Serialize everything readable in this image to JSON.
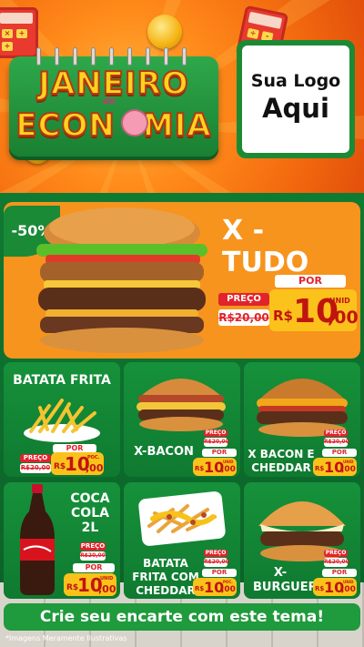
{
  "header": {
    "title_line1": "JANEIRO",
    "title_connector": "de",
    "title_line2_a": "ECON",
    "title_line2_b": "MIA",
    "logo_line1": "Sua Logo",
    "logo_line2": "Aqui",
    "calc_keys": [
      "×",
      "+",
      "÷",
      "-",
      "+",
      "×"
    ]
  },
  "featured": {
    "discount": "-50%",
    "name": "X - TUDO",
    "preco_label": "PREÇO",
    "old_price": "R$20,00",
    "por_label": "POR",
    "currency": "R$",
    "price_int": "10",
    "price_dec": ",00",
    "unit": "UNID"
  },
  "products": [
    {
      "name": "BATATA FRITA",
      "preco_label": "PREÇO",
      "old_price": "R$20,00",
      "por_label": "POR",
      "currency": "R$",
      "price_int": "10",
      "price_dec": ",00",
      "unit": "POC."
    },
    {
      "name": "X-BACON",
      "preco_label": "PREÇO",
      "old_price": "R$20,00",
      "por_label": "POR",
      "currency": "R$",
      "price_int": "10",
      "price_dec": ",00",
      "unit": "UNID"
    },
    {
      "name": "X BACON E CHEDDAR",
      "preco_label": "PREÇO",
      "old_price": "R$20,00",
      "por_label": "POR",
      "currency": "R$",
      "price_int": "10",
      "price_dec": ",00",
      "unit": "UNID"
    },
    {
      "name": "COCA COLA 2L",
      "preco_label": "PREÇO",
      "old_price": "R$20,00",
      "por_label": "POR",
      "currency": "R$",
      "price_int": "10",
      "price_dec": ",00",
      "unit": "UNID"
    },
    {
      "name": "BATATA FRITA COM CHEDDAR",
      "preco_label": "PREÇO",
      "old_price": "R$20,00",
      "por_label": "POR",
      "currency": "R$",
      "price_int": "10",
      "price_dec": ",00",
      "unit": "POC."
    },
    {
      "name": "X-BURGUER",
      "preco_label": "PREÇO",
      "old_price": "R$20,00",
      "por_label": "POR",
      "currency": "R$",
      "price_int": "10",
      "price_dec": ",00",
      "unit": "UNID"
    }
  ],
  "cta": "Crie seu encarte com este tema!",
  "footnote": "*Imagens Meramente Ilustrativas",
  "colors": {
    "green": "#1a8a36",
    "orange": "#f7941d",
    "red": "#e1232b",
    "yellow": "#fbc21b"
  }
}
